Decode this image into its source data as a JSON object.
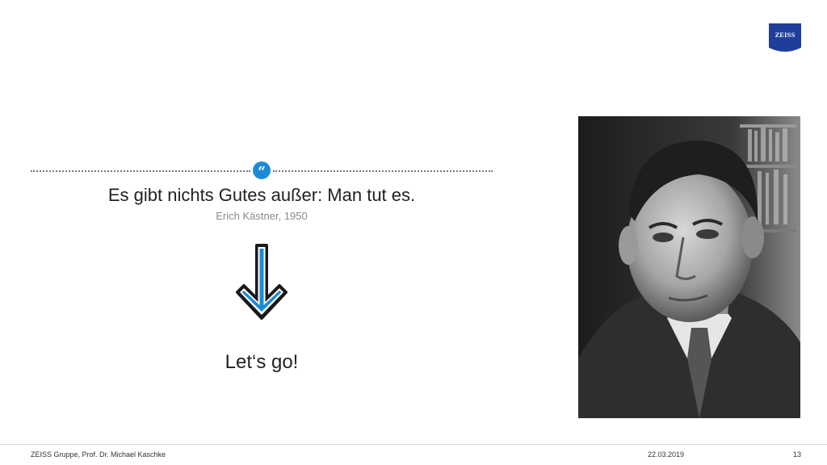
{
  "brand": {
    "logo_text": "ZEISS",
    "accent_color": "#1d8ad6",
    "logo_color": "#1f3d9a"
  },
  "quote": {
    "badge": "“",
    "text": "Es gibt nichts Gutes außer: Man tut es.",
    "author": "Erich Kästner, 1950"
  },
  "arrow": {
    "icon": "down-arrow-icon",
    "color": "#1d8ad6"
  },
  "cta": {
    "text": "Let‘s go!"
  },
  "portrait": {
    "alt": "black-and-white portrait photo"
  },
  "footer": {
    "left": "ZEISS Gruppe, Prof. Dr. Michael Kaschke",
    "date": "22.03.2019",
    "page": "13"
  }
}
